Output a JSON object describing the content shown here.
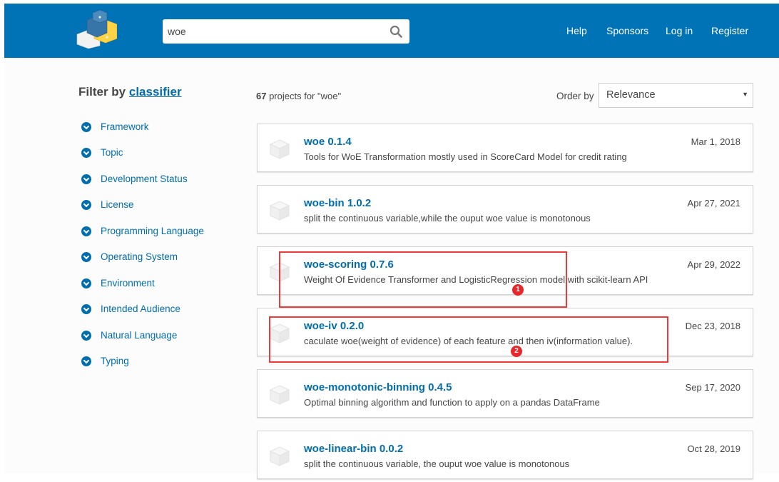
{
  "header": {
    "search_value": "woe",
    "nav": [
      "Help",
      "Sponsors",
      "Log in",
      "Register"
    ],
    "brand_color": "#0073b7"
  },
  "sidebar": {
    "title_prefix": "Filter by",
    "title_link": "classifier",
    "items": [
      "Framework",
      "Topic",
      "Development Status",
      "License",
      "Programming Language",
      "Operating System",
      "Environment",
      "Intended Audience",
      "Natural Language",
      "Typing"
    ]
  },
  "results": {
    "count": "67",
    "count_suffix": " projects for \"woe\"",
    "order_label": "Order by",
    "order_value": "Relevance",
    "items": [
      {
        "name": "woe 0.1.4",
        "desc": "Tools for WoE Transformation mostly used in ScoreCard Model for credit rating",
        "date": "Mar 1, 2018"
      },
      {
        "name": "woe-bin 1.0.2",
        "desc": "split the continuous variable,while the ouput woe value is monotonous",
        "date": "Apr 27, 2021"
      },
      {
        "name": "woe-scoring 0.7.6",
        "desc": "Weight Of Evidence Transformer and LogisticRegression model with scikit-learn API",
        "date": "Apr 29, 2022"
      },
      {
        "name": "woe-iv 0.2.0",
        "desc": "caculate woe(weight of evidence) of each feature and then iv(information value).",
        "date": "Dec 23, 2018"
      },
      {
        "name": "woe-monotonic-binning 0.4.5",
        "desc": "Optimal binning algorithm and function to apply on a pandas DataFrame",
        "date": "Sep 17, 2020"
      },
      {
        "name": "woe-linear-bin 0.0.2",
        "desc": "split the continuous variable, the ouput woe value is monotonous",
        "date": "Oct 28, 2019"
      }
    ]
  },
  "annotations": [
    {
      "label": "1",
      "color": "#f03a3a"
    },
    {
      "label": "2",
      "color": "#f03a3a"
    }
  ]
}
